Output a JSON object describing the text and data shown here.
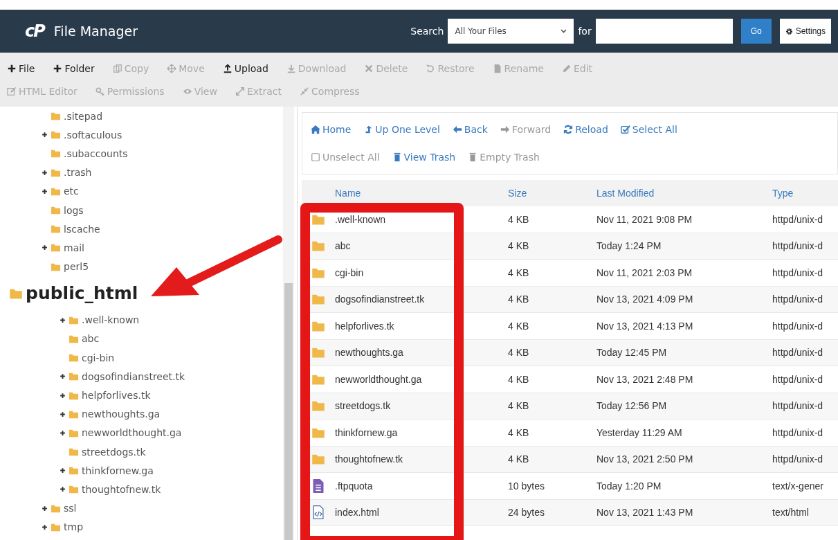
{
  "header": {
    "logo": "cP",
    "title": "File Manager",
    "search_label": "Search",
    "search_scope": "All Your Files",
    "for_label": "for",
    "go": "Go",
    "settings": "Settings"
  },
  "toolbar": [
    {
      "label": "File",
      "disabled": false
    },
    {
      "label": "Folder",
      "disabled": false
    },
    {
      "label": "Copy",
      "disabled": true
    },
    {
      "label": "Move",
      "disabled": true
    },
    {
      "label": "Upload",
      "disabled": false
    },
    {
      "label": "Download",
      "disabled": true
    },
    {
      "label": "Delete",
      "disabled": true
    },
    {
      "label": "Restore",
      "disabled": true
    },
    {
      "label": "Rename",
      "disabled": true
    },
    {
      "label": "Edit",
      "disabled": true
    },
    {
      "label": "HTML Editor",
      "disabled": true
    },
    {
      "label": "Permissions",
      "disabled": true
    },
    {
      "label": "View",
      "disabled": true
    },
    {
      "label": "Extract",
      "disabled": true
    },
    {
      "label": "Compress",
      "disabled": true
    }
  ],
  "tree": [
    {
      "label": ".sitepad",
      "expandable": false
    },
    {
      "label": ".softaculous",
      "expandable": true
    },
    {
      "label": ".subaccounts",
      "expandable": false
    },
    {
      "label": ".trash",
      "expandable": true
    },
    {
      "label": "etc",
      "expandable": true
    },
    {
      "label": "logs",
      "expandable": false
    },
    {
      "label": "lscache",
      "expandable": false
    },
    {
      "label": "mail",
      "expandable": true
    },
    {
      "label": "perl5",
      "expandable": false
    },
    {
      "label": "public_html",
      "expandable": false,
      "magnified": true,
      "children": [
        {
          "label": ".well-known",
          "expandable": true
        },
        {
          "label": "abc",
          "expandable": false
        },
        {
          "label": "cgi-bin",
          "expandable": false
        },
        {
          "label": "dogsofindianstreet.tk",
          "expandable": true
        },
        {
          "label": "helpforlives.tk",
          "expandable": true
        },
        {
          "label": "newthoughts.ga",
          "expandable": true
        },
        {
          "label": "newworldthought.ga",
          "expandable": true
        },
        {
          "label": "streetdogs.tk",
          "expandable": false
        },
        {
          "label": "thinkfornew.ga",
          "expandable": true
        },
        {
          "label": "thoughtofnew.tk",
          "expandable": true
        }
      ]
    },
    {
      "label": "ssl",
      "expandable": true
    },
    {
      "label": "tmp",
      "expandable": true
    }
  ],
  "nav": [
    {
      "label": "Home",
      "disabled": false
    },
    {
      "label": "Up One Level",
      "disabled": false
    },
    {
      "label": "Back",
      "disabled": false
    },
    {
      "label": "Forward",
      "disabled": true
    },
    {
      "label": "Reload",
      "disabled": false
    },
    {
      "label": "Select All",
      "disabled": false
    },
    {
      "label": "Unselect All",
      "disabled": true
    },
    {
      "label": "View Trash",
      "disabled": false
    },
    {
      "label": "Empty Trash",
      "disabled": true
    }
  ],
  "table": {
    "columns": [
      "Name",
      "Size",
      "Last Modified",
      "Type"
    ],
    "rows": [
      {
        "kind": "folder",
        "name": ".well-known",
        "size": "4 KB",
        "modified": "Nov 11, 2021 9:08 PM",
        "type": "httpd/unix-d"
      },
      {
        "kind": "folder",
        "name": "abc",
        "size": "4 KB",
        "modified": "Today 1:24 PM",
        "type": "httpd/unix-d"
      },
      {
        "kind": "folder",
        "name": "cgi-bin",
        "size": "4 KB",
        "modified": "Nov 11, 2021 2:03 PM",
        "type": "httpd/unix-d"
      },
      {
        "kind": "folder",
        "name": "dogsofindianstreet.tk",
        "size": "4 KB",
        "modified": "Nov 13, 2021 4:09 PM",
        "type": "httpd/unix-d"
      },
      {
        "kind": "folder",
        "name": "helpforlives.tk",
        "size": "4 KB",
        "modified": "Nov 13, 2021 4:13 PM",
        "type": "httpd/unix-d"
      },
      {
        "kind": "folder",
        "name": "newthoughts.ga",
        "size": "4 KB",
        "modified": "Today 12:45 PM",
        "type": "httpd/unix-d"
      },
      {
        "kind": "folder",
        "name": "newworldthought.ga",
        "size": "4 KB",
        "modified": "Nov 13, 2021 2:48 PM",
        "type": "httpd/unix-d"
      },
      {
        "kind": "folder",
        "name": "streetdogs.tk",
        "size": "4 KB",
        "modified": "Today 12:56 PM",
        "type": "httpd/unix-d"
      },
      {
        "kind": "folder",
        "name": "thinkfornew.ga",
        "size": "4 KB",
        "modified": "Yesterday 11:29 AM",
        "type": "httpd/unix-d"
      },
      {
        "kind": "folder",
        "name": "thoughtofnew.tk",
        "size": "4 KB",
        "modified": "Nov 13, 2021 2:50 PM",
        "type": "httpd/unix-d"
      },
      {
        "kind": "text",
        "name": ".ftpquota",
        "size": "10 bytes",
        "modified": "Today 1:20 PM",
        "type": "text/x-gener"
      },
      {
        "kind": "html",
        "name": "index.html",
        "size": "24 bytes",
        "modified": "Nov 13, 2021 1:43 PM",
        "type": "text/html"
      }
    ]
  }
}
